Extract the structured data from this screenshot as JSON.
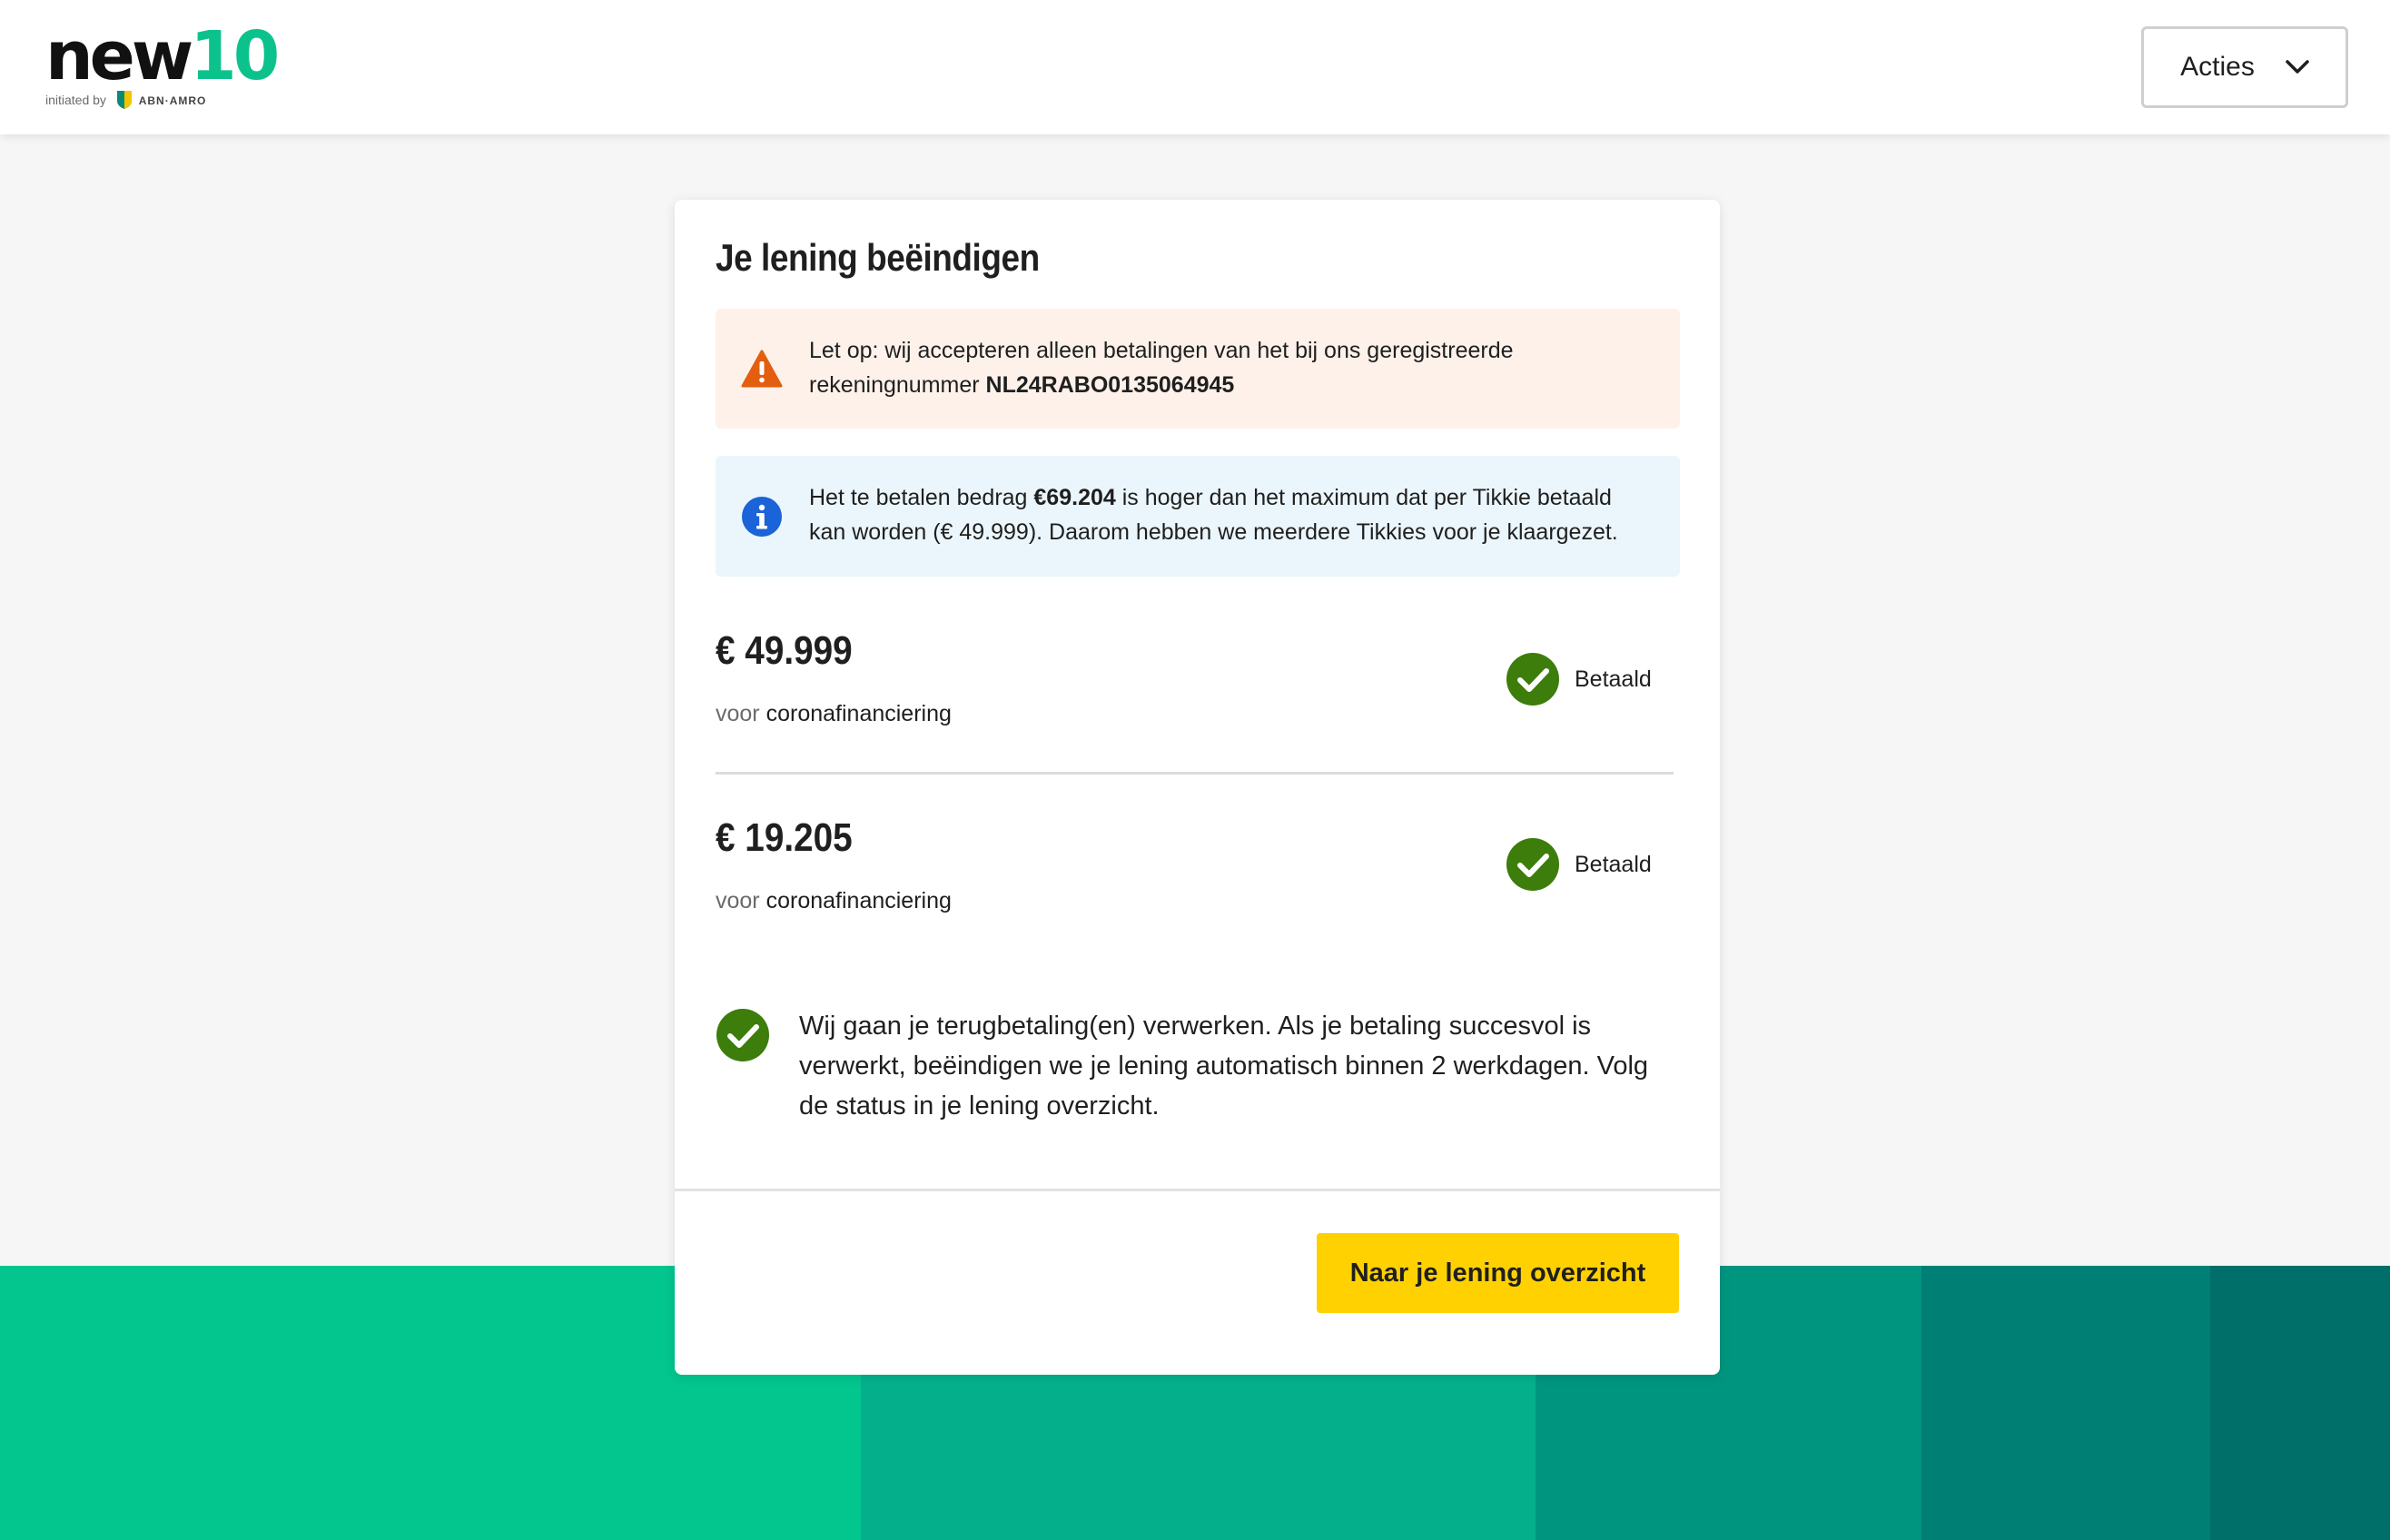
{
  "header": {
    "logo": {
      "brand_part": "new",
      "brand_digits": "10",
      "tagline": "initiated by",
      "partner": "ABN·AMRO"
    },
    "actions_label": "Acties"
  },
  "card": {
    "title": "Je lening beëindigen",
    "warning": {
      "prefix": "Let op: wij accepteren alleen betalingen van het bij ons geregistreerde rekeningnummer ",
      "iban": "NL24RABO0135064945"
    },
    "info": {
      "part1": "Het te betalen bedrag ",
      "amount": "€69.204",
      "part2": " is hoger dan het maximum dat per Tikkie betaald kan worden (€ 49.999). Daarom hebben we meerdere Tikkies voor je klaargezet."
    },
    "payments": [
      {
        "amount": "€ 49.999",
        "prefix": "voor ",
        "purpose": "coronafinanciering",
        "status": "Betaald"
      },
      {
        "amount": "€ 19.205",
        "prefix": "voor ",
        "purpose": "coronafinanciering",
        "status": "Betaald"
      }
    ],
    "confirmation": "Wij gaan je terugbetaling(en) verwerken. Als je betaling succesvol is verwerkt, beëindigen we je lening automatisch binnen 2 werkdagen. Volg de status in je lening overzicht.",
    "primary_button": "Naar je lening overzicht"
  },
  "colors": {
    "brand_green": "#0cc28c",
    "check_green": "#3c7d0b",
    "warning_orange": "#e35e0f",
    "info_blue": "#1a63d8",
    "button_yellow": "#ffd100",
    "footer_band": [
      "#03c58e",
      "#04b08c",
      "#00957f",
      "#007f75",
      "#006f6a"
    ]
  },
  "icons": {
    "actions": "chevron-down-icon",
    "warning": "warning-triangle-icon",
    "info": "info-circle-icon",
    "status": "check-circle-icon"
  }
}
